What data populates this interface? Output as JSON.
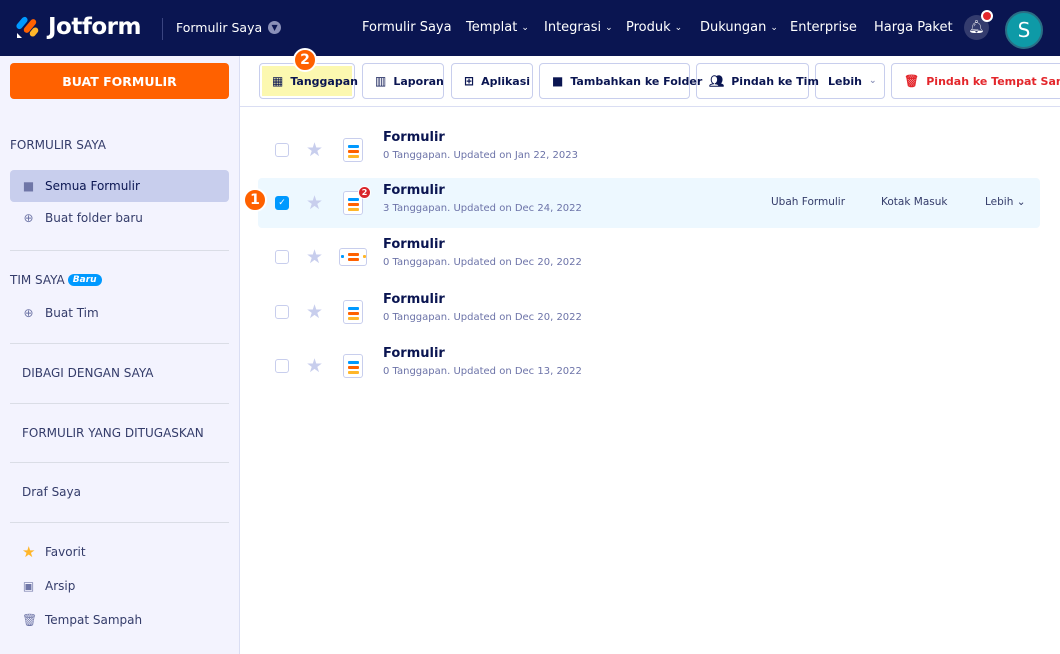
{
  "header": {
    "brand": "Jotform",
    "current": "Formulir Saya",
    "nav": [
      {
        "label": "Formulir Saya",
        "dropdown": false
      },
      {
        "label": "Templat",
        "dropdown": true
      },
      {
        "label": "Integrasi",
        "dropdown": true
      },
      {
        "label": "Produk",
        "dropdown": true
      },
      {
        "label": "Dukungan",
        "dropdown": true
      },
      {
        "label": "Enterprise",
        "dropdown": false
      },
      {
        "label": "Harga Paket",
        "dropdown": false
      }
    ],
    "avatar": "S"
  },
  "sidebar": {
    "create_label": "BUAT FORMULIR",
    "my_forms_heading": "FORMULIR SAYA",
    "all_forms": "Semua Formulir",
    "new_folder": "Buat folder baru",
    "team_heading": "TIM SAYA",
    "new_badge": "Baru",
    "create_team": "Buat Tim",
    "shared": "DIBAGI DENGAN SAYA",
    "assigned": "FORMULIR YANG DITUGASKAN",
    "drafts": "Draf Saya",
    "favorites": "Favorit",
    "archive": "Arsip",
    "trash": "Tempat Sampah"
  },
  "toolbar": {
    "responses": "Tanggapan",
    "reports": "Laporan",
    "apps": "Aplikasi",
    "add_folder": "Tambahkan ke Folder",
    "move_team": "Pindah ke Tim",
    "more": "Lebih",
    "move_trash": "Pindah ke Tempat Sampah"
  },
  "steps": {
    "one": "1",
    "two": "2"
  },
  "forms": [
    {
      "title": "Formulir",
      "subtitle": "0 Tanggapan. Updated on Jan 22, 2023",
      "checked": false
    },
    {
      "title": "Formulir",
      "subtitle": "3 Tanggapan. Updated on Dec 24, 2022",
      "checked": true,
      "badge": "2"
    },
    {
      "title": "Formulir",
      "subtitle": "0 Tanggapan. Updated on Dec 20, 2022",
      "checked": false
    },
    {
      "title": "Formulir",
      "subtitle": "0 Tanggapan. Updated on Dec 20, 2022",
      "checked": false
    },
    {
      "title": "Formulir",
      "subtitle": "0 Tanggapan. Updated on Dec 13, 2022",
      "checked": false
    }
  ],
  "row_actions": {
    "edit": "Ubah Formulir",
    "inbox": "Kotak Masuk",
    "more": "Lebih"
  }
}
